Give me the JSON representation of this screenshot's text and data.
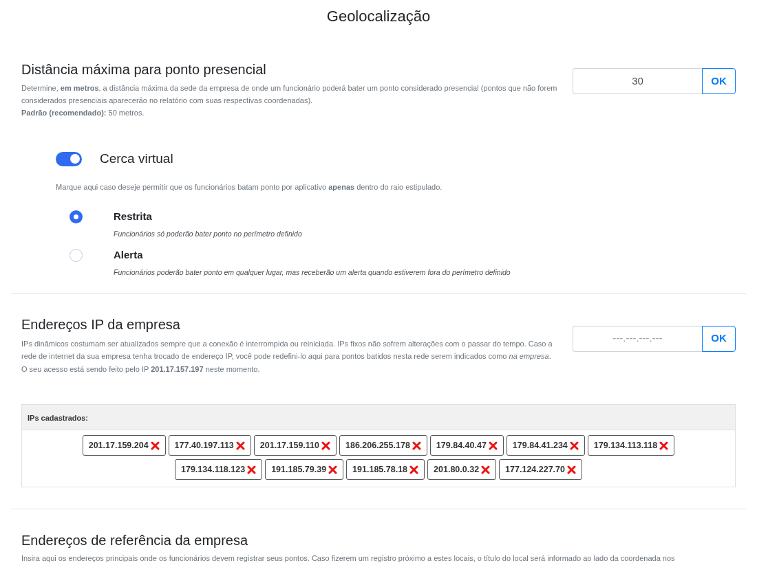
{
  "page_title": "Geolocalização",
  "distance": {
    "title": "Distância máxima para ponto presencial",
    "description": "Determine, **em metros**, a distância máxima da sede da empresa de onde um funcionário poderá bater um ponto considerado presencial (pontos que não forem considerados presenciais aparecerão no relatório com suas respectivas coordenadas).",
    "default_note": "**Padrão (recomendado):** 50 metros.",
    "value": "30",
    "button": "OK"
  },
  "geofence": {
    "on": true,
    "title": "Cerca virtual",
    "description": "Marque aqui caso deseje permitir que os funcionários batam ponto por aplicativo **apenas** dentro do raio estipulado.",
    "options": [
      {
        "label": "Restrita",
        "description": "Funcionários só poderão bater ponto no perímetro definido",
        "selected": true
      },
      {
        "label": "Alerta",
        "description": "Funcionários poderão bater ponto em qualquer lugar, mas receberão um alerta quando estiverem fora do perímetro definido",
        "selected": false
      }
    ]
  },
  "ip": {
    "title": "Endereços IP da empresa",
    "description": "IPs dinâmicos costumam ser atualizados sempre que a conexão é interrompida ou reiniciada. IPs fixos não sofrem alterações com o passar do tempo. Caso a rede de internet da sua empresa tenha trocado de endereço IP, você pode redefini-lo aqui para pontos batidos nesta rede serem indicados como *na empresa*. O seu acesso está sendo feito pelo IP **201.17.157.197** neste momento.",
    "placeholder": "---.---.---.---",
    "button": "OK",
    "registered_title": "IPs cadastrados:",
    "registered": [
      "201.17.159.204",
      "177.40.197.113",
      "201.17.159.110",
      "186.206.255.178",
      "179.84.40.47",
      "179.84.41.234",
      "179.134.113.118",
      "179.134.118.123",
      "191.185.79.39",
      "191.185.78.18",
      "201.80.0.32",
      "177.124.227.70"
    ]
  },
  "addresses": {
    "title": "Endereços de referência da empresa",
    "description": "Insira aqui os endereços principais onde os funcionários devem registrar seus pontos. Caso fizerem um registro próximo a estes locais, o título do local será informado ao lado da coordenada nos"
  }
}
